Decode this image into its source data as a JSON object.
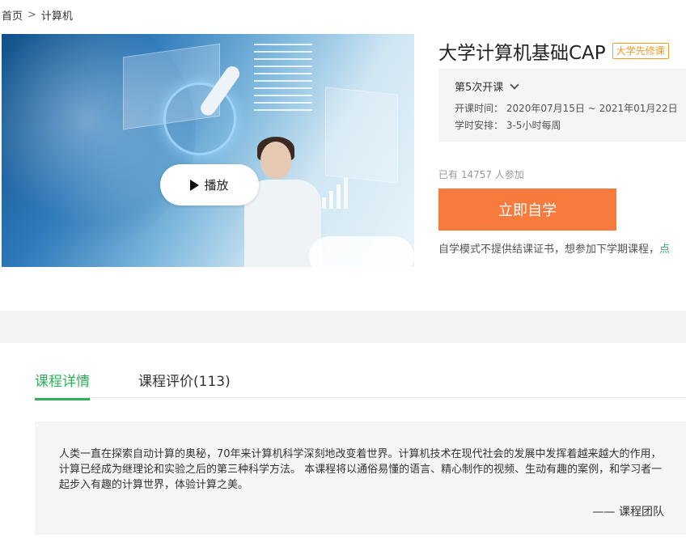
{
  "breadcrumb": {
    "home": "首页",
    "separator": ">",
    "current": "计算机"
  },
  "video": {
    "play_label": "播放"
  },
  "course": {
    "title": "大学计算机基础CAP",
    "badge": "大学先修课"
  },
  "term": {
    "selected": "第5次开课",
    "time_label": "开课时间：",
    "time_value": "2020年07月15日 ~ 2021年01月22日",
    "schedule_label": "学时安排：",
    "schedule_value": "3-5小时每周"
  },
  "enrollment": {
    "text": "已有 14757 人参加"
  },
  "actions": {
    "study_button": "立即自学"
  },
  "note": {
    "text": "自学模式不提供结课证书，想参加下学期课程，",
    "link": "点"
  },
  "tabs": [
    {
      "label": "课程详情",
      "active": true
    },
    {
      "label": "课程评价(113)",
      "active": false
    }
  ],
  "description": {
    "text": "人类一直在探索自动计算的奥秘，70年来计算机科学深刻地改变着世界。计算机技术在现代社会的发展中发挥着越来越大的作用，计算已经成为继理论和实验之后的第三种科学方法。 本课程将以通俗易懂的语言、精心制作的视频、生动有趣的案例，和学习者一起步入有趣的计算世界，体验计算之美。",
    "signature": "—— 课程团队"
  },
  "colors": {
    "accent_green": "#2fb15b",
    "cta_orange": "#f87b3e",
    "badge_orange": "#f59a23"
  }
}
